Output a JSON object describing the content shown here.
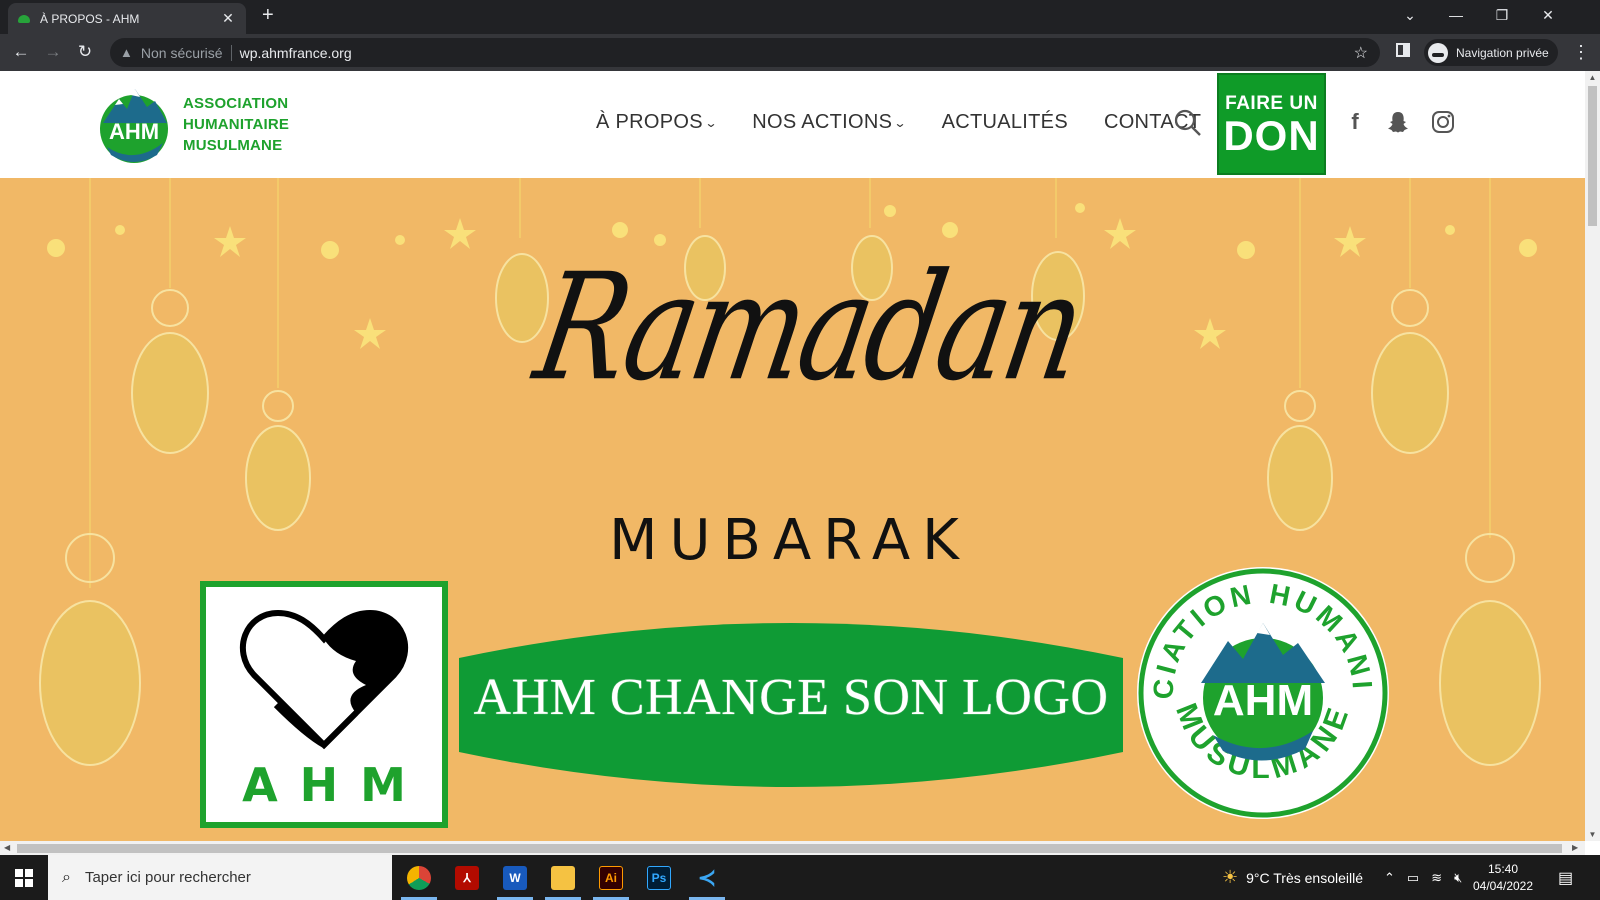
{
  "browser": {
    "tab_title": "À PROPOS - AHM",
    "security_label": "Non sécurisé",
    "url": "wp.ahmfrance.org",
    "profile_label": "Navigation privée"
  },
  "site": {
    "logo_lines": [
      "ASSOCIATION",
      "HUMANITAIRE",
      "MUSULMANE"
    ],
    "logo_mark_text": "AHM",
    "nav": [
      {
        "label": "À PROPOS",
        "dropdown": true
      },
      {
        "label": "NOS ACTIONS",
        "dropdown": true
      },
      {
        "label": "ACTUALITÉS",
        "dropdown": false
      },
      {
        "label": "CONTACT",
        "dropdown": false
      }
    ],
    "donate": {
      "line1": "FAIRE UN",
      "line2": "DON"
    },
    "social_icons": [
      "facebook-icon",
      "snapchat-icon",
      "instagram-icon"
    ],
    "brand_green": "#1ea22d"
  },
  "banner": {
    "script_title": "Ramadan",
    "subtitle": "MUBARAK",
    "old_logo_text": "AHM",
    "headline": "AHM CHANGE SON LOGO",
    "new_logo_ring_top": "ASSOCIATION HUMANITAIRE",
    "new_logo_ring_bottom": "MUSULMANE",
    "new_logo_center": "AHM",
    "background_color": "#f1b866"
  },
  "taskbar": {
    "search_placeholder": "Taper ici pour rechercher",
    "weather": "9°C  Très ensoleillé",
    "time": "15:40",
    "date": "04/04/2022"
  }
}
